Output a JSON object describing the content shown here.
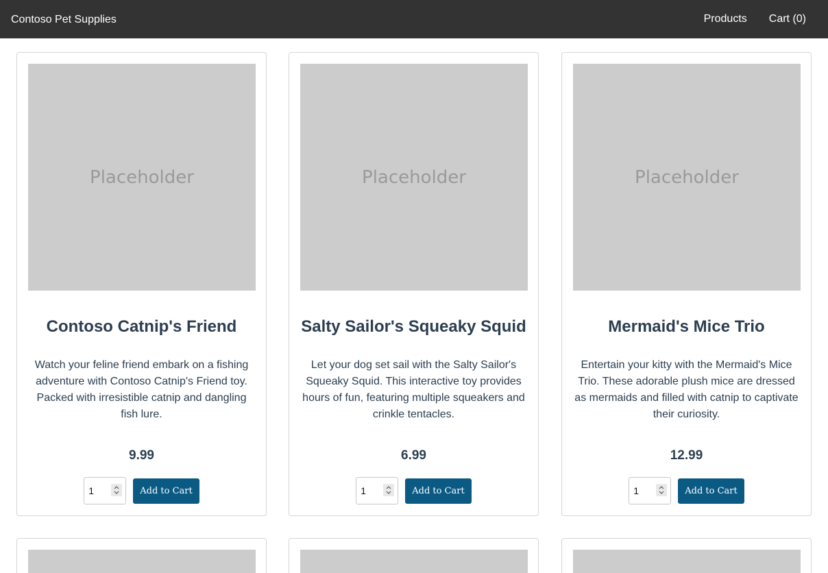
{
  "header": {
    "brand": "Contoso Pet Supplies",
    "nav": {
      "products": "Products",
      "cart": "Cart (0)"
    }
  },
  "products": [
    {
      "placeholder": "Placeholder",
      "title": "Contoso Catnip's Friend",
      "description": "Watch your feline friend embark on a fishing adventure with Contoso Catnip's Friend toy. Packed with irresistible catnip and dangling fish lure.",
      "price": "9.99",
      "quantity": "1",
      "add_label": "Add to Cart"
    },
    {
      "placeholder": "Placeholder",
      "title": "Salty Sailor's Squeaky Squid",
      "description": "Let your dog set sail with the Salty Sailor's Squeaky Squid. This interactive toy provides hours of fun, featuring multiple squeakers and crinkle tentacles.",
      "price": "6.99",
      "quantity": "1",
      "add_label": "Add to Cart"
    },
    {
      "placeholder": "Placeholder",
      "title": "Mermaid's Mice Trio",
      "description": "Entertain your kitty with the Mermaid's Mice Trio. These adorable plush mice are dressed as mermaids and filled with catnip to captivate their curiosity.",
      "price": "12.99",
      "quantity": "1",
      "add_label": "Add to Cart"
    }
  ],
  "colors": {
    "header_bg": "#333333",
    "button_bg": "#0a5a84",
    "placeholder_bg": "#cccccc",
    "text": "#2c3e50"
  }
}
